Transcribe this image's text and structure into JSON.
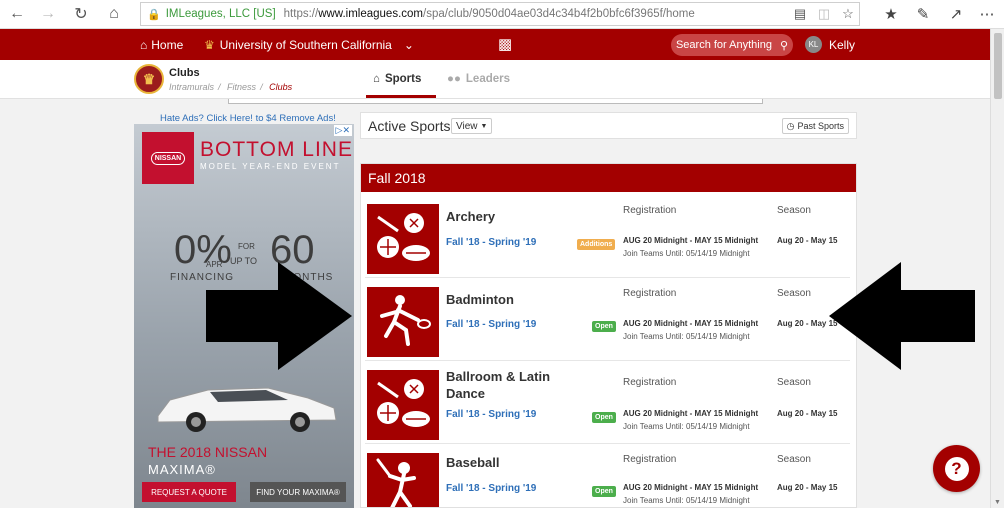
{
  "browser": {
    "site_identity": "IMLeagues, LLC [US]",
    "url_prefix": "https://",
    "url_host": "www.imleagues.com",
    "url_path": "/spa/club/9050d04ae03d4c34b4f2b0bfc6f3965f/home"
  },
  "topnav": {
    "home_label": "Home",
    "school_label": "University of Southern California",
    "search_label": "Search for Anything",
    "user_initials": "KL",
    "user_name": "Kelly"
  },
  "subheader": {
    "title": "Clubs",
    "breadcrumb": [
      "Intramurals",
      "Fitness",
      "Clubs"
    ],
    "tabs": [
      {
        "label": "Sports",
        "active": true
      },
      {
        "label": "Leaders",
        "active": false
      }
    ]
  },
  "ad": {
    "remove_link": "Hate Ads? Click Here! to $4 Remove Ads!",
    "brand_logo": "NISSAN",
    "headline": "BOTTOM LINE",
    "subhead": "MODEL YEAR-END EVENT",
    "rate": "0%",
    "apr": "APR",
    "financing": "FINANCING",
    "for_label": "FOR",
    "up_to": "UP TO",
    "months_number": "60",
    "months": "MONTHS",
    "model_line1": "THE 2018 NISSAN",
    "model_line2": "MAXIMA®",
    "quote_button": "REQUEST A QUOTE",
    "find_button": "FIND YOUR MAXIMA®",
    "brand_color": "#c3102f"
  },
  "active_sports": {
    "title": "Active Sports",
    "view_button": "View",
    "past_button": "Past Sports"
  },
  "season": {
    "title": "Fall 2018",
    "reg_header": "Registration",
    "season_header": "Season",
    "sports": [
      {
        "name": "Archery",
        "term": "Fall '18 - Spring '19",
        "badge": "Additions",
        "badge_type": "additions",
        "reg_dates": "AUG 20 Midnight - MAY 15 Midnight",
        "join_until": "Join Teams Until: 05/14/19 Midnight",
        "season_dates": "Aug 20 - May 15",
        "icon": "multi-sport-icon"
      },
      {
        "name": "Badminton",
        "term": "Fall '18 - Spring '19",
        "badge": "Open",
        "badge_type": "open",
        "reg_dates": "AUG 20 Midnight - MAY 15 Midnight",
        "join_until": "Join Teams Until: 05/14/19 Midnight",
        "season_dates": "Aug 20 - May 15",
        "icon": "badminton-player-icon"
      },
      {
        "name": "Ballroom & Latin Dance",
        "term": "Fall '18 - Spring '19",
        "badge": "Open",
        "badge_type": "open",
        "reg_dates": "AUG 20 Midnight - MAY 15 Midnight",
        "join_until": "Join Teams Until: 05/14/19 Midnight",
        "season_dates": "Aug 20 - May 15",
        "icon": "multi-sport-icon"
      },
      {
        "name": "Baseball",
        "term": "Fall '18 - Spring '19",
        "badge": "Open",
        "badge_type": "open",
        "reg_dates": "AUG 20 Midnight - MAY 15 Midnight",
        "join_until": "Join Teams Until: 05/14/19 Midnight",
        "season_dates": "Aug 20 - May 15",
        "icon": "baseball-batter-icon"
      }
    ]
  },
  "colors": {
    "brand_red": "#a30000",
    "link_blue": "#2e6fb8",
    "open_green": "#4cae4c",
    "additions_orange": "#f0ad4e"
  }
}
